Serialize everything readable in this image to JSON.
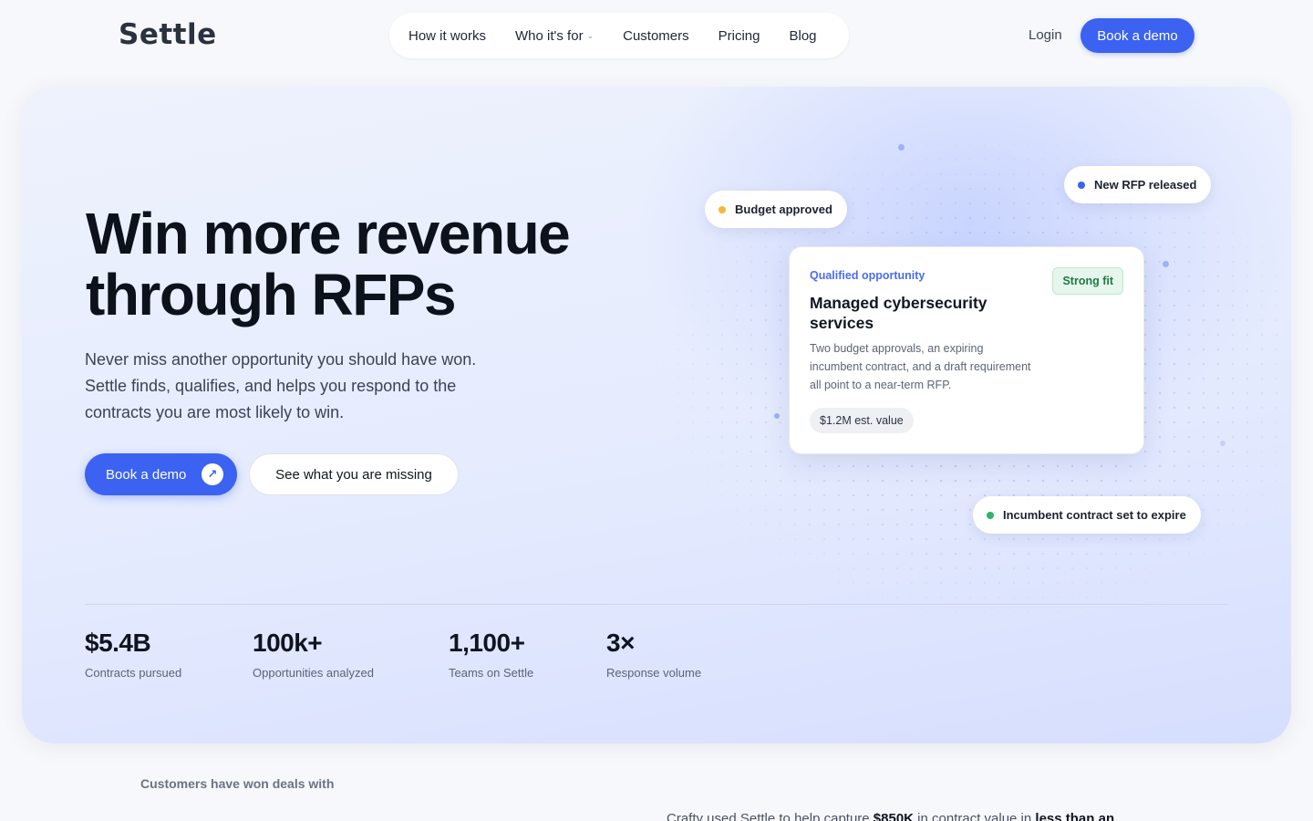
{
  "nav": {
    "logo": "Settle",
    "links": [
      {
        "label": "How it works"
      },
      {
        "label": "Who it's for",
        "has_dropdown": true
      },
      {
        "label": "Customers"
      },
      {
        "label": "Pricing"
      },
      {
        "label": "Blog"
      }
    ],
    "login": "Login",
    "cta": "Book a demo"
  },
  "hero": {
    "headline": "Win more revenue through RFPs",
    "subheadline": "Never miss another opportunity you should have won. Settle finds, qualifies, and helps you respond to the contracts you are most likely to win.",
    "primary_cta": "Book a demo",
    "primary_cta_icon": "arrow-up-right-icon",
    "secondary_cta": "See what you are missing"
  },
  "signals": {
    "budget": {
      "label": "Budget approved",
      "color": "#f5b73b"
    },
    "rfp": {
      "label": "New RFP released",
      "color": "#3b62f1"
    },
    "incumbent": {
      "label": "Incumbent contract set to expire",
      "color": "#2fb36a"
    }
  },
  "opportunity": {
    "kicker": "Qualified opportunity",
    "title": "Managed cybersecurity services",
    "fit": "Strong fit",
    "description": "Two budget approvals, an expiring incumbent contract, and a draft requirement all point to a near-term RFP.",
    "value": "$1.2M est. value"
  },
  "stats": [
    {
      "value": "$5.4B",
      "label": "Contracts pursued"
    },
    {
      "value": "100k+",
      "label": "Opportunities analyzed"
    },
    {
      "value": "1,100+",
      "label": "Teams on Settle"
    },
    {
      "value": "3×",
      "label": "Response volume"
    }
  ],
  "customers": {
    "label": "Customers have won deals with"
  },
  "testimonial": {
    "prefix": "Crafty used Settle to help capture ",
    "amount": "$850K",
    "middle": " in contract value in ",
    "emphasis": "less than an"
  },
  "colors": {
    "accent": "#3b62f1",
    "hero_bg": "#e5ebfe",
    "fit_green": "#1f7a45"
  }
}
